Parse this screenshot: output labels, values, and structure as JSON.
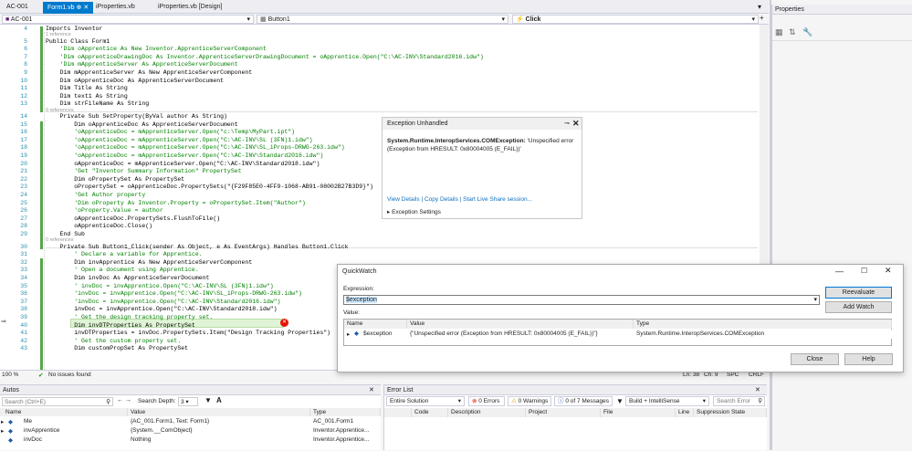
{
  "tabs": {
    "solution": "AC-001",
    "form1": "Form1.vb",
    "iprops": "iProperties.vb",
    "iprops_design": "iProperties.vb [Design]"
  },
  "nav": {
    "project": "AC-001",
    "object": "Button1",
    "event": "Click"
  },
  "editor": {
    "line_numbers": [
      "4",
      "5",
      "6",
      "7",
      "8",
      "9",
      "10",
      "11",
      "12",
      "13",
      "14",
      "15",
      "16",
      "17",
      "18",
      "19",
      "20",
      "21",
      "22",
      "23",
      "24",
      "25",
      "26",
      "27",
      "28",
      "29",
      "30",
      "31",
      "32",
      "33",
      "34",
      "35",
      "36",
      "37",
      "38",
      "39",
      "40",
      "41",
      "42",
      "43"
    ],
    "refs": {
      "r1": "1 reference",
      "r2": "0 references",
      "r3": "0 references"
    },
    "lines": {
      "l4": "Imports Inventor",
      "l5": "Public Class Form1",
      "l6": "    'Dim oApprentice As New Inventor.ApprenticeServerComponent",
      "l7": "    'Dim oApprenticeDrawingDoc As Inventor.ApprenticeServerDrawingDocument = oApprentice.Open(\"C:\\AC-INV\\Standard2016.idw\")",
      "l8": "    'Dim mApprenticeServer As ApprenticeServerDocument",
      "l9": "    Dim mApprenticeServer As New ApprenticeServerComponent",
      "l10": "    Dim oApprenticeDoc As ApprenticeServerDocument",
      "l11": "    Dim Title As String",
      "l12": "    Dim text1 As String",
      "l13": "    Dim strFileName As String",
      "l14": "    Private Sub SetProperty(ByVal author As String)",
      "l15": "        Dim oApprenticeDoc As ApprenticeServerDocument",
      "l16": "        'oApprenticeDoc = mApprenticeServer.Open(\"c:\\Temp\\MyPart.ipt\")",
      "l17": "        'oApprenticeDoc = mApprenticeServer.Open(\"C:\\AC-INV\\SL (3FN)1.idw\")",
      "l18": "        'oApprenticeDoc = mApprenticeServer.Open(\"C:\\AC-INV\\SL_iProps-DRWG-263.idw\")",
      "l19": "        'oApprenticeDoc = mApprenticeServer.Open(\"C:\\AC-INV\\Standard2016.idw\")",
      "l20": "        oApprenticeDoc = mApprenticeServer.Open(\"C:\\AC-INV\\Standard2018.idw\")",
      "l21": "        'Get \"Inventor Summary Information\" PropertySet",
      "l22": "        Dim oPropertySet As PropertySet",
      "l23": "        oPropertySet = oApprenticeDoc.PropertySets(\"{F29F85E0-4FF9-1068-AB91-08002B27B3D9}\")",
      "l24": "        'Get Author property",
      "l25": "        'Dim oProperty As Inventor.Property = oPropertySet.Item(\"Author\")",
      "l26": "        'oProperty.Value = author",
      "l27": "        oApprenticeDoc.PropertySets.FlushToFile()",
      "l28": "        oApprenticeDoc.Close()",
      "l29": "    End Sub",
      "l30": "    Private Sub Button1_Click(sender As Object, e As EventArgs) Handles Button1.Click",
      "l31": "        ' Declare a variable for Apprentice.",
      "l32": "        Dim invApprentice As New ApprenticeServerComponent",
      "l33": "        ' Open a document using Apprentice.",
      "l34": "        Dim invDoc As ApprenticeServerDocument",
      "l35": "        ' invDoc = invApprentice.Open(\"C:\\AC-INV\\SL (3FN)1.idw\")",
      "l36": "        'invDoc = invApprentice.Open(\"C:\\AC-INV\\SL_iProps-DRWG-263.idw\")",
      "l37": "        'invDoc = invApprentice.Open(\"C:\\AC-INV\\Standard2016.idw\")",
      "l38": "        invDoc = invApprentice.Open(\"C:\\AC-INV\\Standard2018.idw\")",
      "l39": "        ' Get the design tracking property set.",
      "l40": "        Dim invDTProperties As PropertySet",
      "l41": "        invDTProperties = invDoc.PropertySets.Item(\"Design Tracking Properties\")",
      "l42": "        ' Get the custom property set.",
      "l43": "        Dim customPropSet As PropertySet"
    }
  },
  "status": {
    "zoom": "100 %",
    "issues": "No issues found",
    "ln": "Ln: 38",
    "ch": "Ch: 9",
    "spc": "SPC",
    "crlf": "CRLF"
  },
  "exception": {
    "title": "Exception Unhandled",
    "type": "System.Runtime.InteropServices.COMException:",
    "message": "'Unspecified error (Exception from HRESULT: 0x80004005 (E_FAIL))'",
    "view_details": "View Details",
    "copy_details": "Copy Details",
    "live_share": "Start Live Share session...",
    "settings": "Exception Settings"
  },
  "quickwatch": {
    "title": "QuickWatch",
    "expression_label": "Expression:",
    "expression": "$exception",
    "value_label": "Value:",
    "reevaluate": "Reevaluate",
    "add_watch": "Add Watch",
    "close": "Close",
    "help": "Help",
    "columns": [
      "Name",
      "Value",
      "Type"
    ],
    "row": {
      "name": "$exception",
      "value": "{\"Unspecified error (Exception from HRESULT: 0x80004005 (E_FAIL))\"}",
      "type": "System.Runtime.InteropServices.COMException"
    }
  },
  "properties": {
    "title": "Properties"
  },
  "autos": {
    "title": "Autos",
    "search_placeholder": "Search (Ctrl+E)",
    "depth_label": "Search Depth:",
    "depth": "3",
    "columns": [
      "Name",
      "Value",
      "Type"
    ],
    "rows": [
      {
        "name": "Me",
        "value": "{AC_001.Form1, Text: Form1}",
        "type": "AC_001.Form1"
      },
      {
        "name": "invApprentice",
        "value": "{System.__ComObject}",
        "type": "Inventor.Apprentice..."
      },
      {
        "name": "invDoc",
        "value": "Nothing",
        "type": "Inventor.Apprentice..."
      }
    ]
  },
  "errorlist": {
    "title": "Error List",
    "scope": "Entire Solution",
    "errors": "0 Errors",
    "warnings": "0 Warnings",
    "messages": "0 of 7 Messages",
    "build": "Build + IntelliSense",
    "search_placeholder": "Search Error",
    "columns": [
      "Code",
      "Description",
      "Project",
      "File",
      "Line",
      "Suppression State"
    ]
  }
}
